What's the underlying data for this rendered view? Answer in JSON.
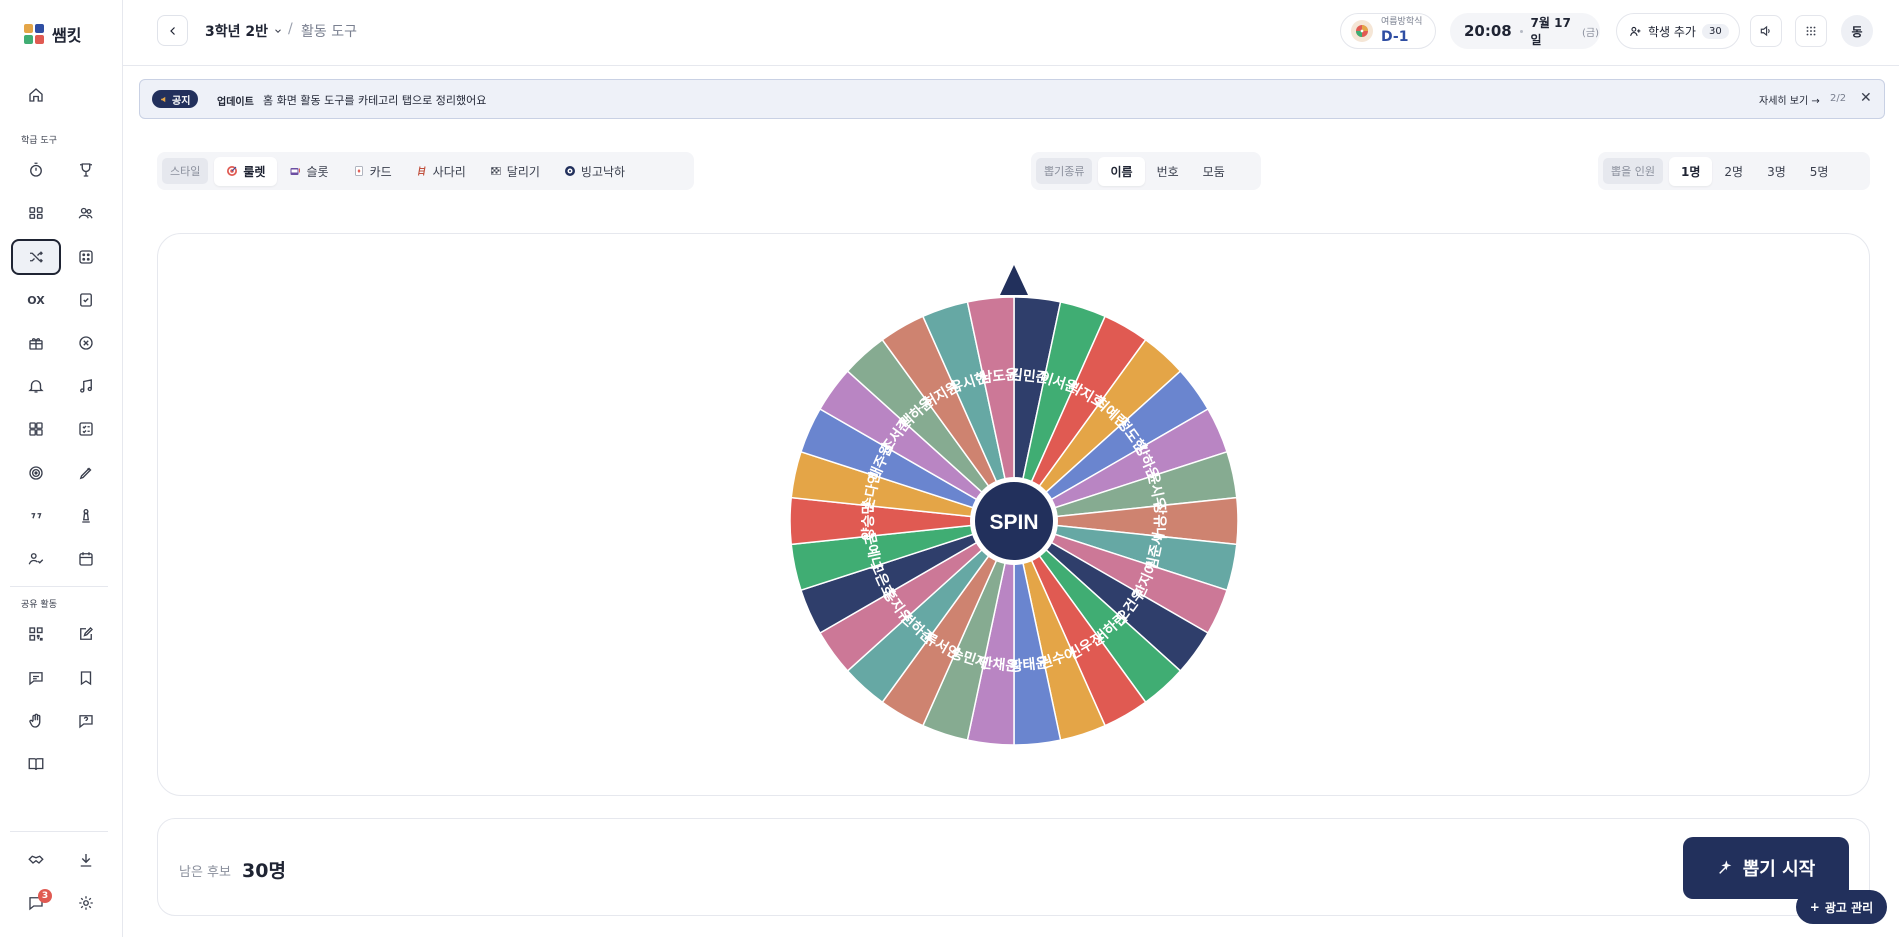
{
  "app": {
    "name": "쌤킷"
  },
  "sidebar": {
    "section_tools": "학급 도구",
    "section_shared": "공유 활동",
    "ox_label": "OX",
    "chat_badge": "3"
  },
  "header": {
    "class_name": "3학년 2반",
    "separator": "/",
    "page_title": "활동 도구",
    "event_label": "여름방학식",
    "event_dday": "D-1",
    "time": "20:08",
    "date": "7월 17일",
    "weekday": "(금)",
    "add_student_label": "학생 추가",
    "student_count": "30",
    "avatar_initial": "동"
  },
  "notice": {
    "tag": "공지",
    "category": "업데이트",
    "message": "홈 화면 활동 도구를 카테고리 탭으로 정리했어요",
    "more": "자세히 보기 →",
    "page": "2/2"
  },
  "style_bar": {
    "label": "스타일",
    "items": [
      {
        "label": "룰렛",
        "icon": "target-icon"
      },
      {
        "label": "슬롯",
        "icon": "slot-machine-icon"
      },
      {
        "label": "카드",
        "icon": "card-icon"
      },
      {
        "label": "사다리",
        "icon": "ladder-icon"
      },
      {
        "label": "달리기",
        "icon": "checkered-flag-icon"
      },
      {
        "label": "빙고낙하",
        "icon": "bingo-ball-icon"
      }
    ],
    "active_index": 0
  },
  "type_bar": {
    "label": "뽑기종류",
    "items": [
      "이름",
      "번호",
      "모둠"
    ],
    "active_index": 0
  },
  "count_bar": {
    "label": "뽑을 인원",
    "items": [
      "1명",
      "2명",
      "3명",
      "5명"
    ],
    "active_index": 0
  },
  "wheel": {
    "center_label": "SPIN",
    "colors": {
      "navy": "#2f3e6b",
      "green": "#40ad73",
      "red": "#e05a52",
      "orange": "#e4a547",
      "blue": "#6a85cf",
      "purple": "#b985c3",
      "sage": "#86ab91",
      "coral": "#ce8370",
      "teal": "#66a8a4",
      "pink": "#cc7897"
    },
    "segments": [
      {
        "name": "김민준",
        "color": "navy"
      },
      {
        "name": "이서윤",
        "color": "green"
      },
      {
        "name": "박지호",
        "color": "red"
      },
      {
        "name": "최예린",
        "color": "orange"
      },
      {
        "name": "정도현",
        "color": "blue"
      },
      {
        "name": "강하은",
        "color": "purple"
      },
      {
        "name": "윤시우",
        "color": "sage"
      },
      {
        "name": "장유나",
        "color": "coral"
      },
      {
        "name": "임준서",
        "color": "teal"
      },
      {
        "name": "한지아",
        "color": "pink"
      },
      {
        "name": "오건우",
        "color": "navy"
      },
      {
        "name": "서하린",
        "color": "green"
      },
      {
        "name": "신우진",
        "color": "red"
      },
      {
        "name": "권수아",
        "color": "orange"
      },
      {
        "name": "황태윤",
        "color": "blue"
      },
      {
        "name": "안채은",
        "color": "purple"
      },
      {
        "name": "송민재",
        "color": "sage"
      },
      {
        "name": "류서연",
        "color": "coral"
      },
      {
        "name": "전하준",
        "color": "teal"
      },
      {
        "name": "홍지유",
        "color": "pink"
      },
      {
        "name": "고은호",
        "color": "navy"
      },
      {
        "name": "문예나",
        "color": "green"
      },
      {
        "name": "양승민",
        "color": "red"
      },
      {
        "name": "손다인",
        "color": "orange"
      },
      {
        "name": "배주원",
        "color": "blue"
      },
      {
        "name": "조서준",
        "color": "purple"
      },
      {
        "name": "백하윤",
        "color": "sage"
      },
      {
        "name": "허지원",
        "color": "coral"
      },
      {
        "name": "유시현",
        "color": "teal"
      },
      {
        "name": "남도윤",
        "color": "pink"
      }
    ]
  },
  "bottom": {
    "remaining_label": "남은 후보",
    "remaining_value": "30명",
    "start_label": "뽑기 시작",
    "ad_label": "광고 관리"
  }
}
